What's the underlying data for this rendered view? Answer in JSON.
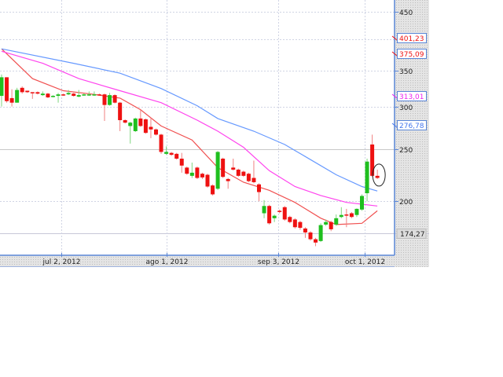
{
  "chart_data": {
    "type": "candlestick",
    "title": "",
    "xlabel": "",
    "ylabel": "",
    "yscale": "log",
    "ylim": [
      164,
      520
    ],
    "grid": true,
    "colors": {
      "up": "#1fbf1f",
      "down": "#ee1111",
      "ma_short": "#f05050",
      "ma_mid": "#ff44ee",
      "ma_long": "#6699ff",
      "panel": "#d8d8d8",
      "axis": "#5a86d6"
    },
    "y_ticks": [
      {
        "value": 450,
        "label": "450",
        "style": "dash"
      },
      {
        "value": 400,
        "label": "",
        "style": "dash"
      },
      {
        "value": 350,
        "label": "350",
        "style": "dash"
      },
      {
        "value": 300,
        "label": "300",
        "style": "dash"
      },
      {
        "value": 250,
        "label": "250",
        "style": "solid"
      },
      {
        "value": 200,
        "label": "200",
        "style": "dash"
      }
    ],
    "x_ticks": [
      {
        "index": 11.6,
        "label": "jul 2, 2012"
      },
      {
        "index": 32,
        "label": "ago 1, 2012"
      },
      {
        "index": 53.7,
        "label": "sep 3, 2012"
      },
      {
        "index": 70.5,
        "label": "oct 1, 2012"
      }
    ],
    "price_line": {
      "value": 174.27,
      "label": "174,27"
    },
    "value_labels": [
      {
        "value": 401.23,
        "label": "401,23",
        "color": "#ee1111"
      },
      {
        "value": 375.09,
        "label": "375,09",
        "color": "#ee1111"
      },
      {
        "value": 313.01,
        "label": "313,01",
        "color": "#ee22ee"
      },
      {
        "value": 276.78,
        "label": "276,78",
        "color": "#4477ee"
      }
    ],
    "candles": [
      [
        314,
        340,
        344,
        300
      ],
      [
        340,
        307,
        340,
        305
      ],
      [
        311,
        305,
        323,
        300
      ],
      [
        305,
        322,
        325,
        305
      ],
      [
        325,
        319,
        327,
        317
      ],
      [
        321,
        319,
        321,
        318
      ],
      [
        319,
        318,
        319,
        310
      ],
      [
        319,
        317,
        320,
        316
      ],
      [
        315,
        317,
        320,
        314
      ],
      [
        317,
        312,
        318,
        311
      ],
      [
        313,
        314,
        315,
        312
      ],
      [
        314,
        316,
        318,
        305
      ],
      [
        316,
        315,
        317,
        314
      ],
      [
        316,
        318,
        322,
        315
      ],
      [
        317,
        314,
        318,
        313
      ],
      [
        313,
        315,
        322,
        312
      ],
      [
        315,
        316,
        317,
        314
      ],
      [
        315,
        316,
        320,
        314
      ],
      [
        315,
        316,
        320,
        314
      ],
      [
        316,
        315,
        317,
        314
      ],
      [
        316,
        302,
        317,
        282
      ],
      [
        302,
        315,
        318,
        301
      ],
      [
        315,
        305,
        316,
        304
      ],
      [
        305,
        283,
        306,
        270
      ],
      [
        283,
        280,
        284,
        279
      ],
      [
        276,
        280,
        281,
        256
      ],
      [
        270,
        285,
        286,
        269
      ],
      [
        285,
        276,
        296,
        275
      ],
      [
        284,
        268,
        285,
        267
      ],
      [
        275,
        272,
        286,
        262
      ],
      [
        272,
        266,
        273,
        265
      ],
      [
        266,
        247,
        267,
        245
      ],
      [
        245,
        247,
        253,
        244
      ],
      [
        246,
        244,
        247,
        243
      ],
      [
        245,
        240,
        246,
        239
      ],
      [
        240,
        233,
        246,
        226
      ],
      [
        231,
        225,
        232,
        224
      ],
      [
        223,
        226,
        236,
        221
      ],
      [
        231,
        221,
        232,
        220
      ],
      [
        225,
        221.5,
        226,
        220
      ],
      [
        224,
        213,
        225,
        212
      ],
      [
        214,
        206,
        215,
        205
      ],
      [
        211,
        247,
        248,
        210
      ],
      [
        240,
        222,
        241,
        221
      ],
      [
        220,
        218,
        221,
        211
      ],
      [
        231,
        229,
        240,
        228
      ],
      [
        229,
        223,
        230,
        222
      ],
      [
        227,
        223,
        228,
        222
      ],
      [
        225,
        218,
        226,
        217
      ],
      [
        221,
        217,
        238,
        216
      ],
      [
        215,
        208,
        216,
        200
      ],
      [
        190,
        196,
        201,
        186
      ],
      [
        196,
        182,
        197,
        181
      ],
      [
        186,
        188,
        189,
        183
      ],
      [
        192,
        191,
        193,
        190
      ],
      [
        195,
        185,
        196,
        184
      ],
      [
        187,
        183,
        188,
        182
      ],
      [
        185,
        179,
        186,
        178
      ],
      [
        183,
        178.5,
        184,
        177
      ],
      [
        178,
        175,
        179,
        171
      ],
      [
        175,
        170,
        176,
        169
      ],
      [
        170,
        167.6,
        171,
        165
      ],
      [
        168.7,
        180.6,
        182,
        168
      ],
      [
        181,
        183,
        185,
        180
      ],
      [
        183,
        177.4,
        184,
        176
      ],
      [
        181,
        186,
        189,
        180
      ],
      [
        187,
        188.6,
        195,
        186
      ],
      [
        189,
        188.6,
        193.6,
        179
      ],
      [
        190,
        187,
        191,
        186
      ],
      [
        188.6,
        193.6,
        194,
        187
      ],
      [
        193,
        204.6,
        206,
        192
      ],
      [
        207,
        237,
        240,
        200
      ],
      [
        255,
        223,
        266,
        222
      ],
      [
        223,
        221,
        229,
        220
      ]
    ],
    "candle_fields": [
      "open",
      "close",
      "high",
      "low"
    ],
    "highlight_candle_index": 73,
    "moving_averages": [
      {
        "name": "ma_short",
        "color": "#f05050",
        "points": [
          [
            0,
            384
          ],
          [
            6,
            338
          ],
          [
            12,
            321
          ],
          [
            18,
            316
          ],
          [
            23,
            311
          ],
          [
            27,
            296
          ],
          [
            31,
            276
          ],
          [
            37,
            260
          ],
          [
            42,
            231
          ],
          [
            47,
            217
          ],
          [
            52,
            209.6
          ],
          [
            57,
            199
          ],
          [
            62,
            186
          ],
          [
            65,
            181
          ],
          [
            70,
            182
          ],
          [
            73,
            192
          ]
        ]
      },
      {
        "name": "ma_mid",
        "color": "#ff44ee",
        "points": [
          [
            0,
            380
          ],
          [
            8,
            361
          ],
          [
            15,
            338
          ],
          [
            23,
            321
          ],
          [
            31,
            305
          ],
          [
            38,
            283
          ],
          [
            42,
            270
          ],
          [
            47,
            252
          ],
          [
            52,
            228
          ],
          [
            57,
            213
          ],
          [
            62,
            205
          ],
          [
            67,
            199
          ],
          [
            73,
            196
          ]
        ]
      },
      {
        "name": "ma_long",
        "color": "#6699ff",
        "points": [
          [
            0,
            384
          ],
          [
            14,
            361
          ],
          [
            23,
            346
          ],
          [
            31,
            324
          ],
          [
            38,
            301
          ],
          [
            42,
            285
          ],
          [
            49,
            270
          ],
          [
            55,
            255
          ],
          [
            60,
            239
          ],
          [
            65,
            224
          ],
          [
            70,
            213
          ],
          [
            73,
            209
          ]
        ]
      }
    ]
  }
}
